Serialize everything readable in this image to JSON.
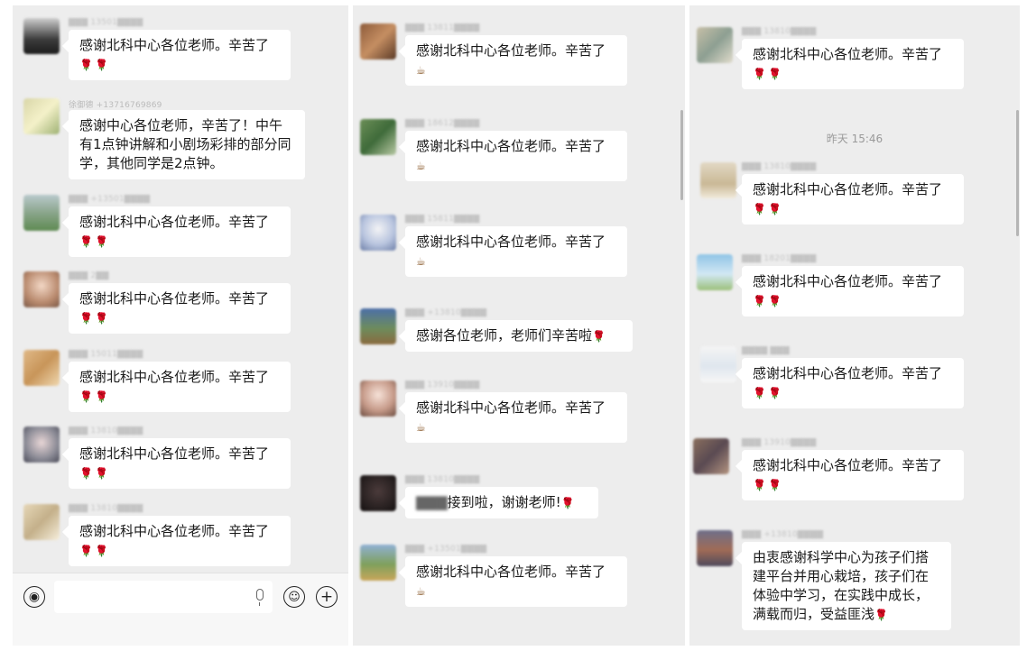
{
  "messages": {
    "thanks_full": "感谢北科中心各位老师。辛苦了",
    "thanks_long": "感谢中心各位老师，辛苦了！中午有1点钟讲解和小剧场彩排的部分同学，其他同学是2点钟。",
    "thanks_short": "感谢各位老师，老师们辛苦啦",
    "received_suffix": "接到啦，谢谢老师!",
    "closing_long": "由衷感谢科学中心为孩子们搭建平台并用心栽培，孩子们在体验中学习，在实践中成长，满载而归，受益匪浅"
  },
  "senders": {
    "visible": "徐御德 +13716769869"
  },
  "timestamp": "昨天 15:46",
  "icons": {
    "rose": "rose-emoji",
    "coffee": "coffee-emoji",
    "voice": "voice-icon",
    "mic": "microphone-icon",
    "emoji": "emoji-icon",
    "plus": "plus-icon"
  },
  "colors": {
    "chat_bg": "#ededed",
    "bubble": "#ffffff",
    "rose": "#d8242f"
  }
}
